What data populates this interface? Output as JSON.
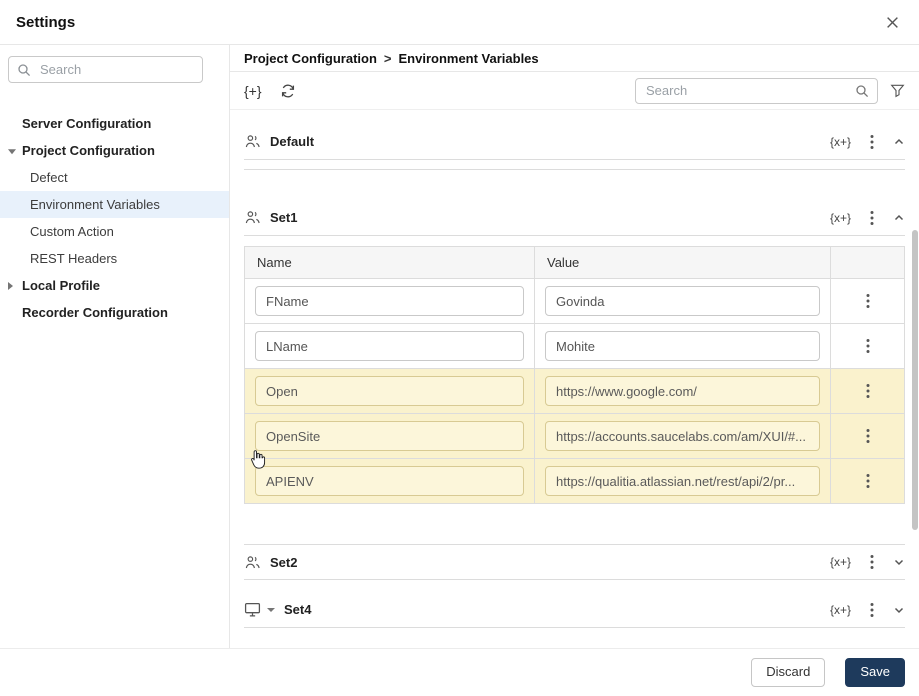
{
  "window": {
    "title": "Settings"
  },
  "sidebar": {
    "search": {
      "placeholder": "Search"
    },
    "items": [
      {
        "label": "Server Configuration"
      },
      {
        "label": "Project Configuration"
      },
      {
        "label": "Defect"
      },
      {
        "label": "Environment Variables"
      },
      {
        "label": "Custom Action"
      },
      {
        "label": "REST Headers"
      },
      {
        "label": "Local Profile"
      },
      {
        "label": "Recorder Configuration"
      }
    ]
  },
  "breadcrumb": {
    "part1": "Project Configuration",
    "separator": ">",
    "part2": "Environment Variables"
  },
  "toolbar": {
    "add_variable_label": "{+}",
    "search_placeholder": "Search"
  },
  "sections": {
    "default": {
      "name": "Default",
      "xvar_label": "{x+}"
    },
    "set1": {
      "name": "Set1",
      "xvar_label": "{x+}"
    },
    "set2": {
      "name": "Set2",
      "xvar_label": "{x+}"
    },
    "set4": {
      "name": "Set4",
      "xvar_label": "{x+}"
    }
  },
  "table": {
    "columns": {
      "name": "Name",
      "value": "Value"
    },
    "rows": [
      {
        "name": "FName",
        "value": "Govinda",
        "highlight": false
      },
      {
        "name": "LName",
        "value": "Mohite",
        "highlight": false
      },
      {
        "name": "Open",
        "value": "https://www.google.com/",
        "highlight": true
      },
      {
        "name": "OpenSite",
        "value": "https://accounts.saucelabs.com/am/XUI/#...",
        "highlight": true
      },
      {
        "name": "APIENV",
        "value": "https://qualitia.atlassian.net/rest/api/2/pr...",
        "highlight": true
      }
    ]
  },
  "footer": {
    "discard_label": "Discard",
    "save_label": "Save"
  },
  "colors": {
    "selected_item_bg": "#e8f1fb",
    "highlight_row_bg": "#faf2cd",
    "save_button_bg": "#1e3a5c"
  }
}
